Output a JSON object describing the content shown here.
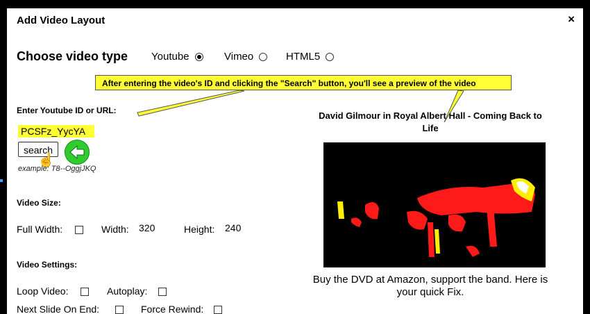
{
  "dialog": {
    "title": "Add Video Layout",
    "close_label": "×"
  },
  "video_type": {
    "heading": "Choose video type",
    "options": [
      {
        "label": "Youtube",
        "checked": true
      },
      {
        "label": "Vimeo",
        "checked": false
      },
      {
        "label": "HTML5",
        "checked": false
      }
    ]
  },
  "tooltip": {
    "text": "After entering the video's ID and clicking the \"Search\" button, you'll see a preview of the video"
  },
  "youtube_id": {
    "label": "Enter Youtube ID or URL:",
    "value": "PCSFz_YycYA",
    "search_label": "search",
    "example": "example: T8--OggjJKQ"
  },
  "video_size": {
    "heading": "Video Size:",
    "full_width_label": "Full Width:",
    "width_label": "Width:",
    "width_value": "320",
    "height_label": "Height:",
    "height_value": "240"
  },
  "video_settings": {
    "heading": "Video Settings:",
    "loop_label": "Loop Video:",
    "autoplay_label": "Autoplay:",
    "next_slide_label": "Next Slide On End:",
    "force_rewind_label": "Force Rewind:"
  },
  "preview": {
    "title": "David Gilmour in Royal Albert Hall - Coming Back to Life",
    "caption": "Buy the DVD at Amazon, support the band. Here is your quick Fix."
  },
  "colors": {
    "highlight": "#ffff33",
    "accent_green": "#2ecc2e"
  }
}
